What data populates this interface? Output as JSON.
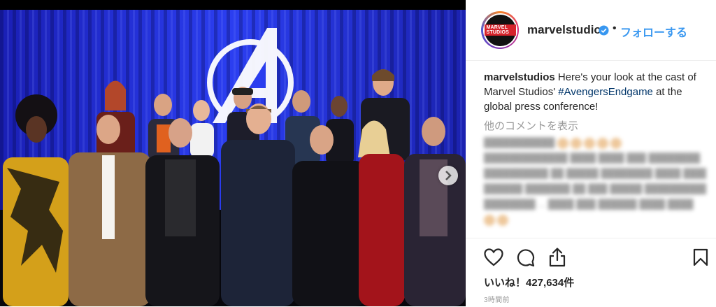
{
  "post": {
    "username": "marvelstudios",
    "avatar_logo": "MARVEL STUDIOS",
    "dot": "•",
    "follow_label": "フォローする",
    "caption_user": "marvelstudios",
    "caption_text_1": " Here's your look at the cast of Marvel Studios' ",
    "caption_hashtag": "#AvengersEndgame",
    "caption_text_2": " at the global press conference!",
    "more_comments": "他のコメントを表示",
    "likes": "いいね！427,634件",
    "time": "3時間前"
  },
  "icons": {
    "verified": "verified-badge-icon",
    "next": "chevron-right-icon",
    "like": "heart-icon",
    "comment": "comment-icon",
    "share": "share-icon",
    "save": "bookmark-icon"
  },
  "colors": {
    "link_blue": "#3897f0",
    "hashtag": "#003569",
    "text": "#262626",
    "muted": "#999999",
    "stage_blue": "#1d2fd8"
  }
}
